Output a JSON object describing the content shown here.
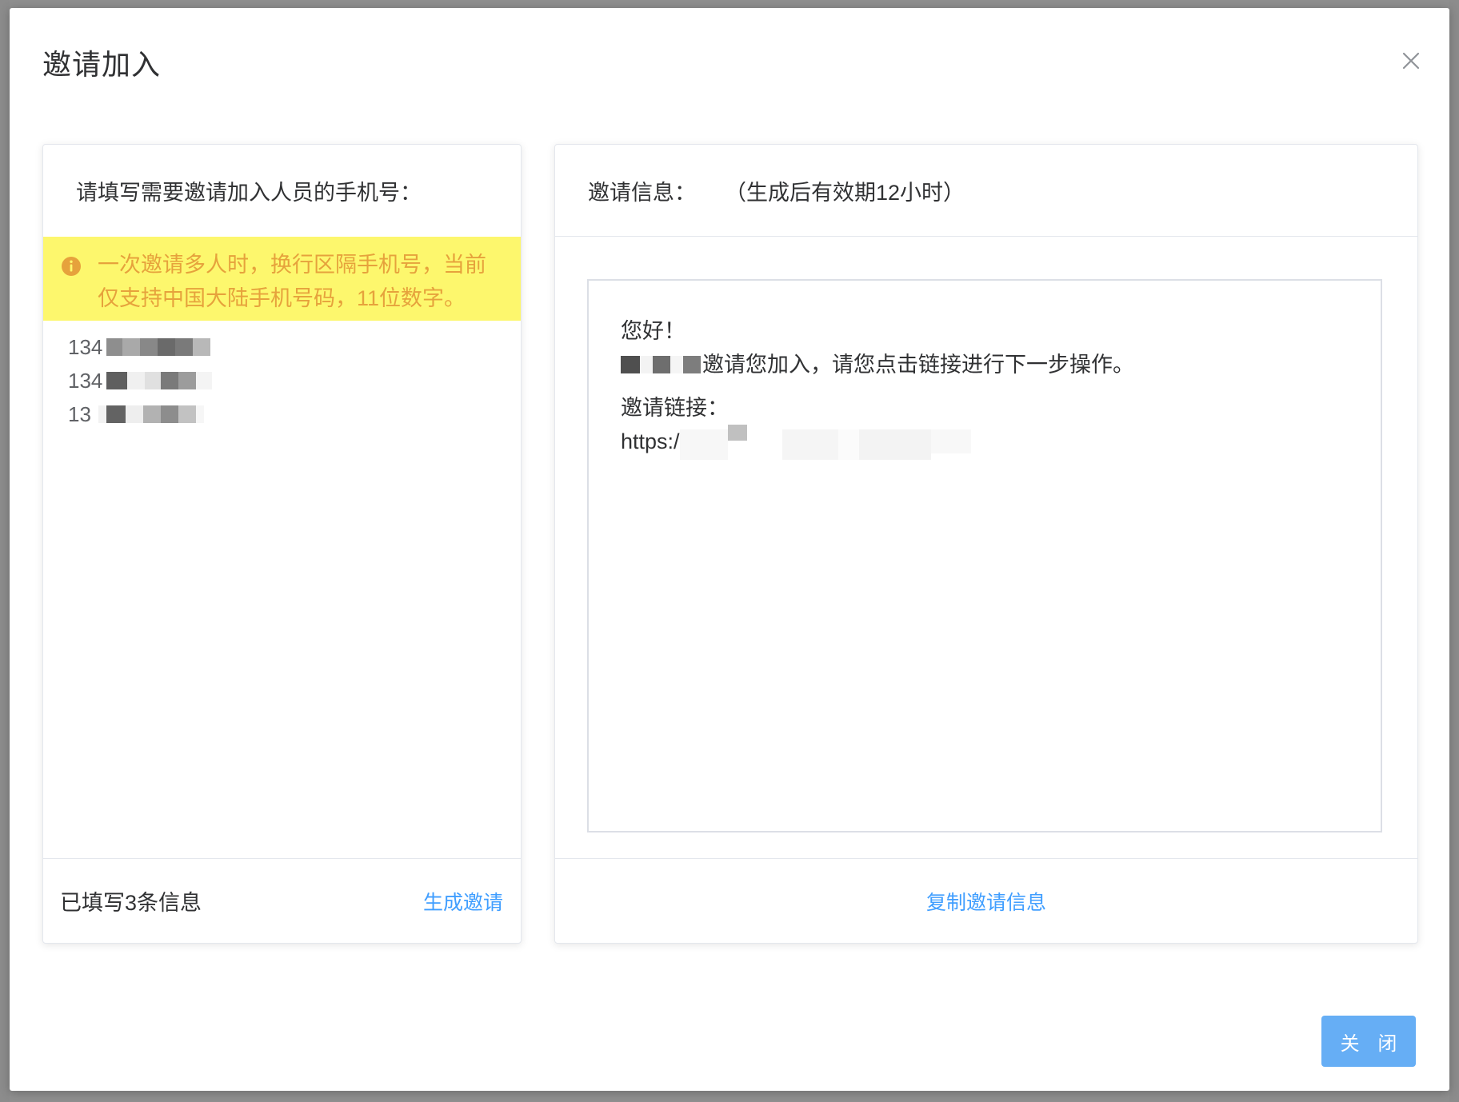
{
  "dialog": {
    "title": "邀请加入",
    "close_button_label": "关 闭"
  },
  "left_panel": {
    "header": "请填写需要邀请加入人员的手机号：",
    "warning": "一次邀请多人时，换行区隔手机号，当前仅支持中国大陆手机号码，11位数字。",
    "phones": [
      {
        "prefix": "134"
      },
      {
        "prefix": "134"
      },
      {
        "prefix": "13"
      }
    ],
    "count_text": "已填写3条信息",
    "generate_label": "生成邀请"
  },
  "right_panel": {
    "header": "邀请信息：",
    "header_note": "（生成后有效期12小时）",
    "greeting": "您好！",
    "invite_text": "邀请您加入，请您点击链接进行下一步操作。",
    "link_label": "邀请链接：",
    "link_prefix": "https:/",
    "copy_label": "复制邀请信息"
  },
  "colors": {
    "warning_bg": "#fdf76d",
    "warning_text": "#e6a23c",
    "link": "#409eff",
    "primary_button": "#66aef5"
  },
  "icons": {
    "close": "close-icon",
    "warning": "info-circle-icon"
  }
}
